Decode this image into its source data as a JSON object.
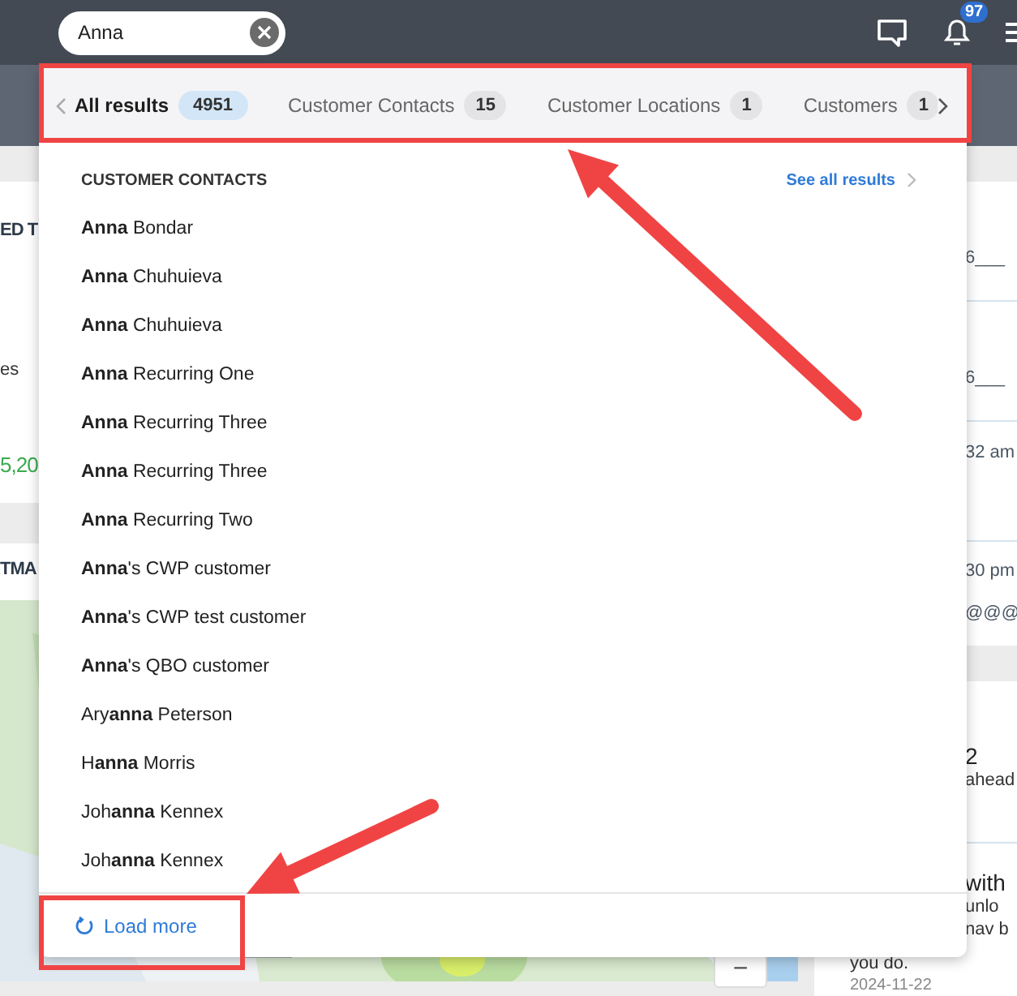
{
  "top_bar": {
    "search": {
      "value": "Anna"
    },
    "notification_count": "97"
  },
  "search_tabs": [
    {
      "label": "All results",
      "count": "4951",
      "selected": true
    },
    {
      "label": "Customer Contacts",
      "count": "15",
      "selected": false
    },
    {
      "label": "Customer Locations",
      "count": "1",
      "selected": false
    },
    {
      "label": "Customers",
      "count": "1",
      "selected": false
    }
  ],
  "results": {
    "section_title": "CUSTOMER CONTACTS",
    "see_all": "See all results",
    "items": [
      "**Anna** Bondar",
      "**Anna** Chuhuieva",
      "**Anna** Chuhuieva",
      "**Anna** Recurring One",
      "**Anna** Recurring Three",
      "**Anna** Recurring Three",
      "**Anna** Recurring Two",
      "**Anna**'s CWP customer",
      "**Anna**'s CWP test customer",
      "**Anna**'s QBO customer",
      "Ary**anna** Peterson",
      "H**anna** Morris",
      "Joh**anna** Kennex",
      "Joh**anna** Kennex"
    ],
    "load_more": "Load more"
  },
  "background": {
    "summary_card": {
      "heading": "ED T",
      "label": "es",
      "amount": "5,20"
    },
    "map_card": {
      "heading": "TMA",
      "zoom_out": "−"
    },
    "activity_rows": [
      {
        "lines": [
          "6___"
        ]
      },
      {
        "lines": [
          "6___"
        ]
      },
      {
        "lines": [
          "32 am"
        ]
      },
      {
        "lines": [
          "30 pm",
          "@@@"
        ]
      }
    ],
    "news": [
      {
        "title": "2",
        "lines": [
          "ahead"
        ]
      },
      {
        "title": "with",
        "lines": [
          "unlo",
          "nav b"
        ],
        "tail": "you do.",
        "date": "2024-11-22"
      }
    ]
  }
}
